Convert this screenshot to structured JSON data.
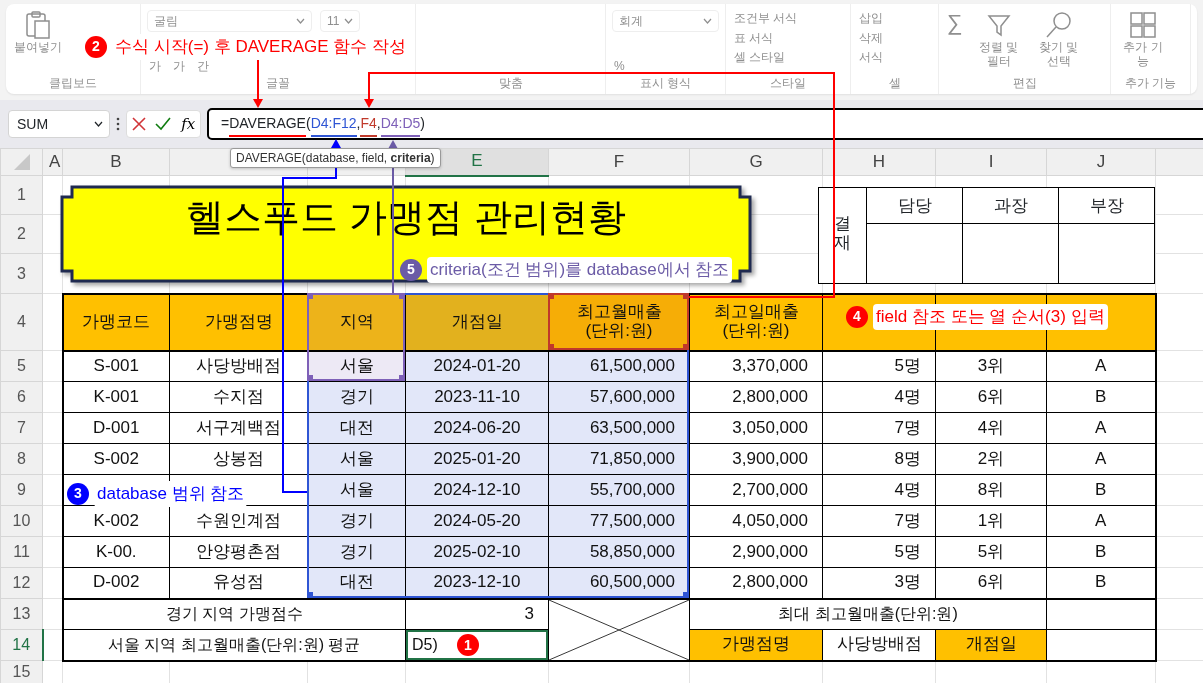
{
  "ribbon": {
    "disabled": true,
    "groups": [
      {
        "label": "클립보드",
        "items": [
          {
            "text": "붙여넣기",
            "kind": "large"
          }
        ]
      },
      {
        "label": "글꼴",
        "items": [
          {
            "text": "굴림",
            "kind": "dropdown"
          },
          {
            "text": "11",
            "kind": "dropdown"
          },
          {
            "text": "가",
            "kind": "small"
          },
          {
            "text": "가",
            "kind": "small"
          },
          {
            "text": "간",
            "kind": "small"
          }
        ]
      },
      {
        "label": "맞춤"
      },
      {
        "label": "표시 형식",
        "items": [
          {
            "text": "회계",
            "kind": "dropdown"
          },
          {
            "text": "%",
            "kind": "small"
          }
        ]
      },
      {
        "label": "스타일",
        "items": [
          {
            "text": "조건부 서식",
            "kind": "small"
          },
          {
            "text": "표 서식",
            "kind": "small"
          },
          {
            "text": "셀 스타일",
            "kind": "small"
          }
        ]
      },
      {
        "label": "셀",
        "items": [
          {
            "text": "삽입",
            "kind": "small"
          },
          {
            "text": "삭제",
            "kind": "small"
          },
          {
            "text": "서식",
            "kind": "small"
          }
        ]
      },
      {
        "label": "편집",
        "items": [
          {
            "text": "∑",
            "kind": "large"
          },
          {
            "text": "정렬 및 필터",
            "kind": "large"
          },
          {
            "text": "찾기 및 선택",
            "kind": "large"
          }
        ]
      },
      {
        "label": "추가 기능",
        "items": [
          {
            "text": "추가 기능",
            "kind": "large"
          }
        ]
      }
    ]
  },
  "formula_bar": {
    "name_box": "SUM",
    "function_button": "fx",
    "parts": [
      {
        "text": "=",
        "kind": "plain"
      },
      {
        "text": "DAVERAGE",
        "kind": "function",
        "color": "#ff0000"
      },
      {
        "text": "(",
        "kind": "plain"
      },
      {
        "text": "D4:F12",
        "kind": "ref",
        "color": "#2f55d4"
      },
      {
        "text": ",",
        "kind": "plain"
      },
      {
        "text": "F4",
        "kind": "ref",
        "color": "#c0392b"
      },
      {
        "text": ",",
        "kind": "plain"
      },
      {
        "text": "D4:D5",
        "kind": "ref",
        "color": "#7e60b8"
      },
      {
        "text": ")",
        "kind": "plain"
      }
    ],
    "tooltip": "DAVERAGE(database, field, **criteria**)"
  },
  "sheet": {
    "columns": [
      {
        "label": "A",
        "selected": false
      },
      {
        "label": "B",
        "selected": false
      },
      {
        "selected": false
      },
      {
        "selected": false
      },
      {
        "label": "E",
        "selected": true
      },
      {
        "label": "F",
        "selected": false
      },
      {
        "label": "G",
        "selected": false
      },
      {
        "label": "H",
        "selected": false
      },
      {
        "label": "I",
        "selected": false
      },
      {
        "label": "J",
        "selected": false
      }
    ],
    "rows": [
      {
        "label": "1",
        "selected": false
      },
      {
        "label": "2",
        "selected": false
      },
      {
        "label": "3",
        "selected": false
      },
      {
        "label": "4",
        "selected": false
      },
      {
        "label": "5",
        "selected": false
      },
      {
        "label": "6",
        "selected": false
      },
      {
        "label": "7",
        "selected": false
      },
      {
        "label": "8",
        "selected": false
      },
      {
        "label": "9",
        "selected": false
      },
      {
        "label": "10",
        "selected": false
      },
      {
        "label": "11",
        "selected": false
      },
      {
        "label": "12",
        "selected": false
      },
      {
        "label": "13",
        "selected": false
      },
      {
        "label": "14",
        "selected": true
      },
      {
        "label": "15",
        "selected": false
      }
    ],
    "title": "헬스푸드 가맹점 관리현황",
    "approval": {
      "label": "결재",
      "roles": [
        "담당",
        "과장",
        "부장"
      ]
    },
    "table": {
      "headers": [
        "가맹코드",
        "가맹점명",
        "지역",
        "개점일",
        "최고월매출\n(단위:원)",
        "최고일매출\n(단위:원)"
      ],
      "rows": [
        {
          "code": "S-001",
          "name": "사당방배점",
          "region": "서울",
          "opened": "2024-01-20",
          "monthly": "61,500,000",
          "daily": "3,370,000",
          "staff": "5명",
          "rank": "3위",
          "grade": "A"
        },
        {
          "code": "K-001",
          "name": "수지점",
          "region": "경기",
          "opened": "2023-11-10",
          "monthly": "57,600,000",
          "daily": "2,800,000",
          "staff": "4명",
          "rank": "6위",
          "grade": "B"
        },
        {
          "code": "D-001",
          "name": "서구계백점",
          "region": "대전",
          "opened": "2024-06-20",
          "monthly": "63,500,000",
          "daily": "3,050,000",
          "staff": "7명",
          "rank": "4위",
          "grade": "A"
        },
        {
          "code": "S-002",
          "name": "상봉점",
          "region": "서울",
          "opened": "2025-01-20",
          "monthly": "71,850,000",
          "daily": "3,900,000",
          "staff": "8명",
          "rank": "2위",
          "grade": "A"
        },
        {
          "region": "서울",
          "opened": "2024-12-10",
          "monthly": "55,700,000",
          "daily": "2,700,000",
          "staff": "4명",
          "rank": "8위",
          "grade": "B"
        },
        {
          "code": "K-002",
          "name": "수원인계점",
          "region": "경기",
          "opened": "2024-05-20",
          "monthly": "77,500,000",
          "daily": "4,050,000",
          "staff": "7명",
          "rank": "1위",
          "grade": "A"
        },
        {
          "code": "K-00.",
          "name": "안양평촌점",
          "region": "경기",
          "opened": "2025-02-10",
          "monthly": "58,850,000",
          "daily": "2,900,000",
          "staff": "5명",
          "rank": "5위",
          "grade": "B"
        },
        {
          "code": "D-002",
          "name": "유성점",
          "region": "대전",
          "opened": "2023-12-10",
          "monthly": "60,500,000",
          "daily": "2,800,000",
          "staff": "3명",
          "rank": "6위",
          "grade": "B"
        }
      ]
    },
    "summary": {
      "count_label": "경기 지역 가맹점수",
      "count_value": "3",
      "avg_label": "서울 지역 최고월매출(단위:원) 평균",
      "editing_text": "D5)",
      "max_label": "최대 최고월매출(단위:원)",
      "name_label": "가맹점명",
      "name_value": "사당방배점",
      "date_label": "개점일"
    }
  },
  "callouts": [
    {
      "number": "1",
      "color": "#ff0000"
    },
    {
      "number": "2",
      "text": "수식 시작(=) 후 DAVERAGE 함수 작성",
      "color": "#ff0000"
    },
    {
      "number": "3",
      "text": "database 범위 참조",
      "color": "#0000ff"
    },
    {
      "number": "4",
      "text": "field 참조 또는 열 순서(3) 입력",
      "color": "#ff0000"
    },
    {
      "number": "5",
      "text": "criteria(조건 범위)를 database에서 참조",
      "color": "#6b5ba6"
    }
  ]
}
